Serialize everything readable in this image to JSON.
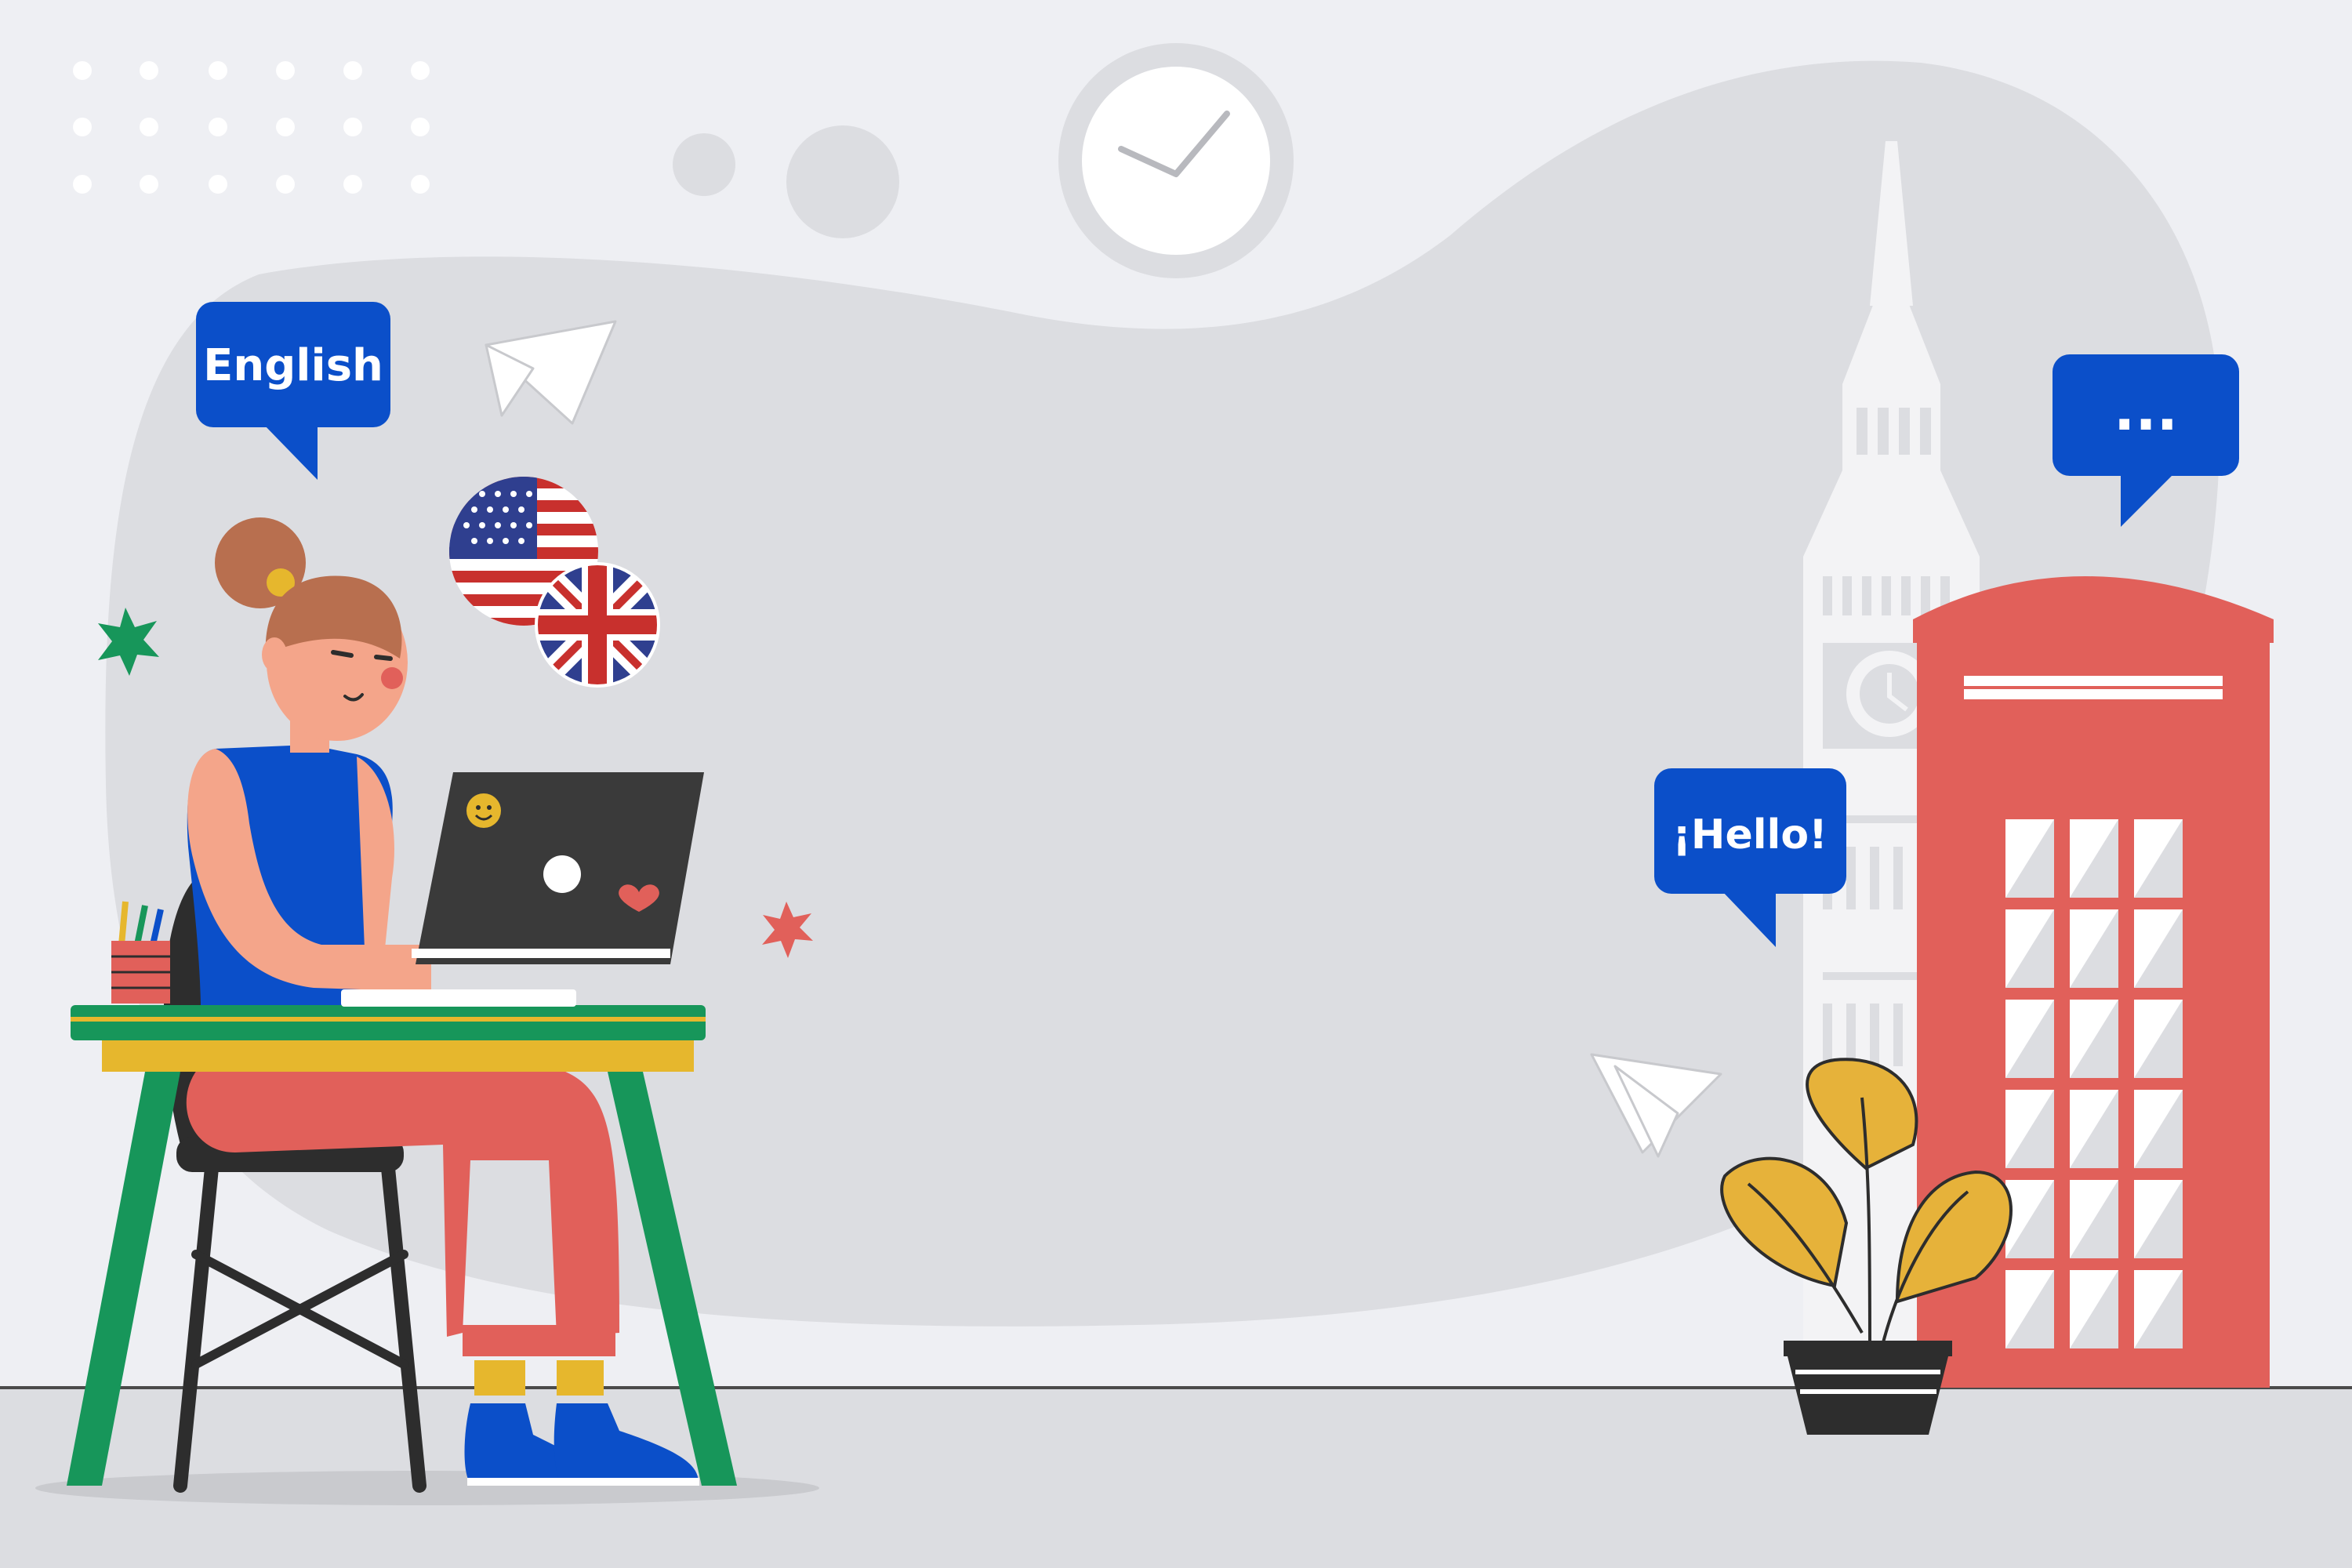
{
  "bubbles": {
    "english": "English",
    "hello": "¡Hello!",
    "typing": "..."
  },
  "icons": {
    "clock": "clock-icon",
    "paper_plane": "paper-plane-icon",
    "star": "star-icon",
    "heart": "heart-icon",
    "smiley": "smiley-icon",
    "flag_us": "us-flag-icon",
    "flag_uk": "uk-flag-icon"
  },
  "colors": {
    "background": "#eeeff3",
    "blob": "#dcdde1",
    "bubble_blue": "#0b4fc9",
    "booth_red": "#e1605a",
    "desk_green": "#17965a",
    "desk_yellow": "#e6b72d",
    "laptop": "#3a3a3a",
    "plant_yellow": "#e6b23a",
    "tower": "#f3f3f5"
  }
}
